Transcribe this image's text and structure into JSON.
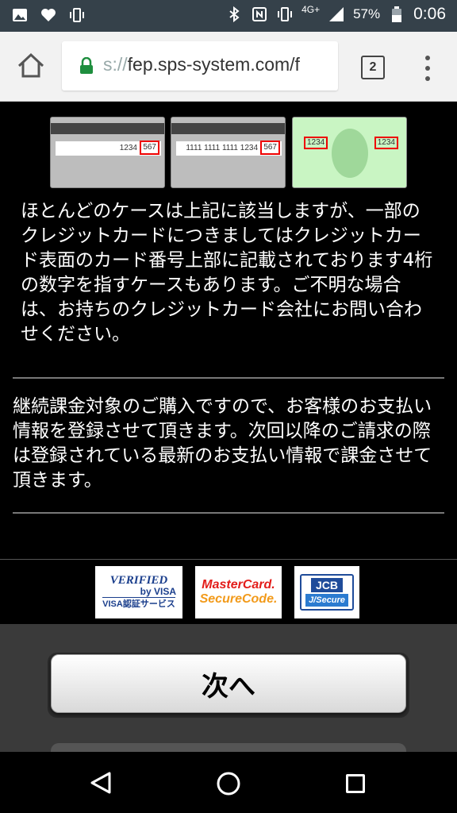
{
  "status_bar": {
    "network": "4G+",
    "battery": "57%",
    "time": "0:06",
    "icons": [
      "image-icon",
      "heart-icon",
      "vibrate-icon",
      "bluetooth-icon",
      "nfc-icon",
      "vibrate-icon",
      "signal-icon",
      "battery-icon"
    ]
  },
  "browser": {
    "url_prefix": "s://",
    "url_main": "fep.sps-system.com/f",
    "tab_count": "2",
    "secure_color": "#1e8e3e"
  },
  "cards": {
    "back1": {
      "number": "1234",
      "cvc": "567"
    },
    "back2": {
      "number": "1111 1111 1111 1234",
      "cvc": "567"
    },
    "front": {
      "left_code": "1234",
      "right_code": "1234"
    }
  },
  "content": {
    "para1": "ほとんどのケースは上記に該当しますが、一部のクレジットカードにつきましてはクレジットカード表面のカード番号上部に記載されております4桁の数字を指すケースもあります。ご不明な場合は、お持ちのクレジットカード会社にお問い合わせください。",
    "para2": "継続課金対象のご購入ですので、お客様のお支払い情報を登録させて頂きます。次回以降のご請求の際は登録されている最新のお支払い情報で課金させて頂きます。"
  },
  "logos": {
    "visa": {
      "line1": "VERIFIED",
      "line2": "by VISA",
      "line3": "VISA認証サービス"
    },
    "mastercard": {
      "line1": "MasterCard.",
      "line2": "SecureCode."
    },
    "jcb": {
      "line1": "JCB",
      "line2": "J/Secure"
    }
  },
  "actions": {
    "next_label": "次へ"
  }
}
